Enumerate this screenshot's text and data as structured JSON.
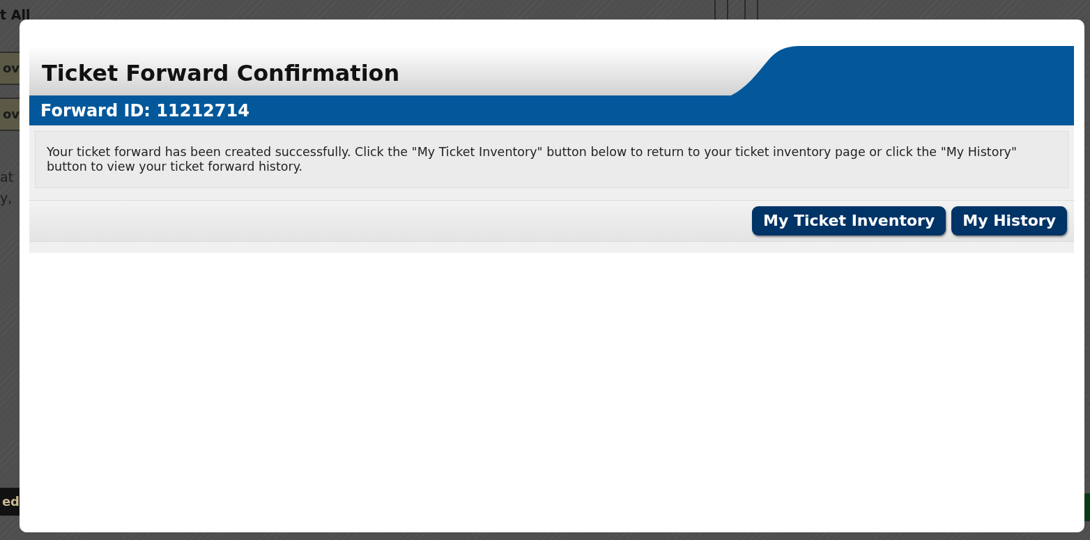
{
  "backdrop": {
    "fragments": [
      {
        "text": "t All",
        "kind": "heading"
      },
      {
        "text": "ov",
        "kind": "tile"
      },
      {
        "text": "ov",
        "kind": "tile"
      },
      {
        "text": "at",
        "kind": "plain"
      },
      {
        "text": "y,",
        "kind": "plain"
      },
      {
        "text": "ed",
        "kind": "bar"
      }
    ]
  },
  "dialog": {
    "title": "Ticket Forward Confirmation",
    "subtitle": "Forward ID: 11212714",
    "message": "Your ticket forward has been created successfully. Click the \"My Ticket Inventory\" button below to return to your ticket inventory page or click the \"My History\" button to view your ticket forward history.",
    "buttons": [
      "My Ticket Inventory",
      "My History"
    ]
  }
}
